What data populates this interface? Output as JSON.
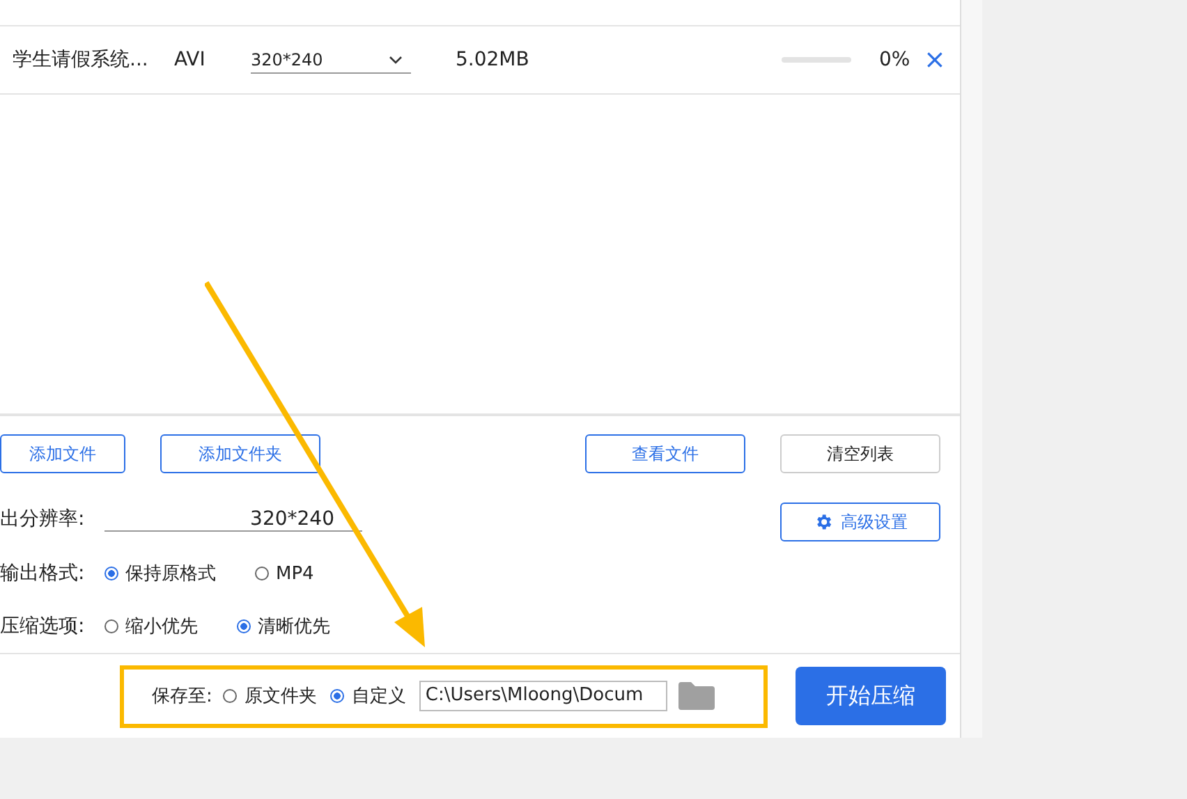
{
  "files": [
    {
      "name": "学生请假系统...",
      "format": "AVI",
      "resolution": "320*240",
      "size": "5.02MB",
      "level": 0,
      "percent": "0%",
      "remove": "×"
    }
  ],
  "buttons": [
    {
      "label": "添加文件",
      "kind": "primary"
    },
    {
      "label": "添加文件夹",
      "kind": "primary"
    },
    {
      "label": "查看文件",
      "kind": "primary"
    },
    {
      "label": "清空列表",
      "kind": "plain"
    }
  ],
  "resolution": {
    "label": "出分辨率:",
    "value": "320*240"
  },
  "advanced_button": "高级设置",
  "options": [
    {
      "label": "输出格式:",
      "choices": [
        {
          "label": "保持原格式",
          "selected": true
        },
        {
          "label": "MP4",
          "selected": false
        }
      ]
    },
    {
      "label": "压缩选项:",
      "choices": [
        {
          "label": "缩小优先",
          "selected": false
        },
        {
          "label": "清晰优先",
          "selected": true
        }
      ]
    }
  ],
  "save": {
    "label": "保存至:",
    "choices": [
      {
        "label": "原文件夹",
        "selected": false
      },
      {
        "label": "自定义",
        "selected": true
      }
    ],
    "path": "C:\\Users\\Mloong\\Docum"
  },
  "start_button": "开始压缩"
}
